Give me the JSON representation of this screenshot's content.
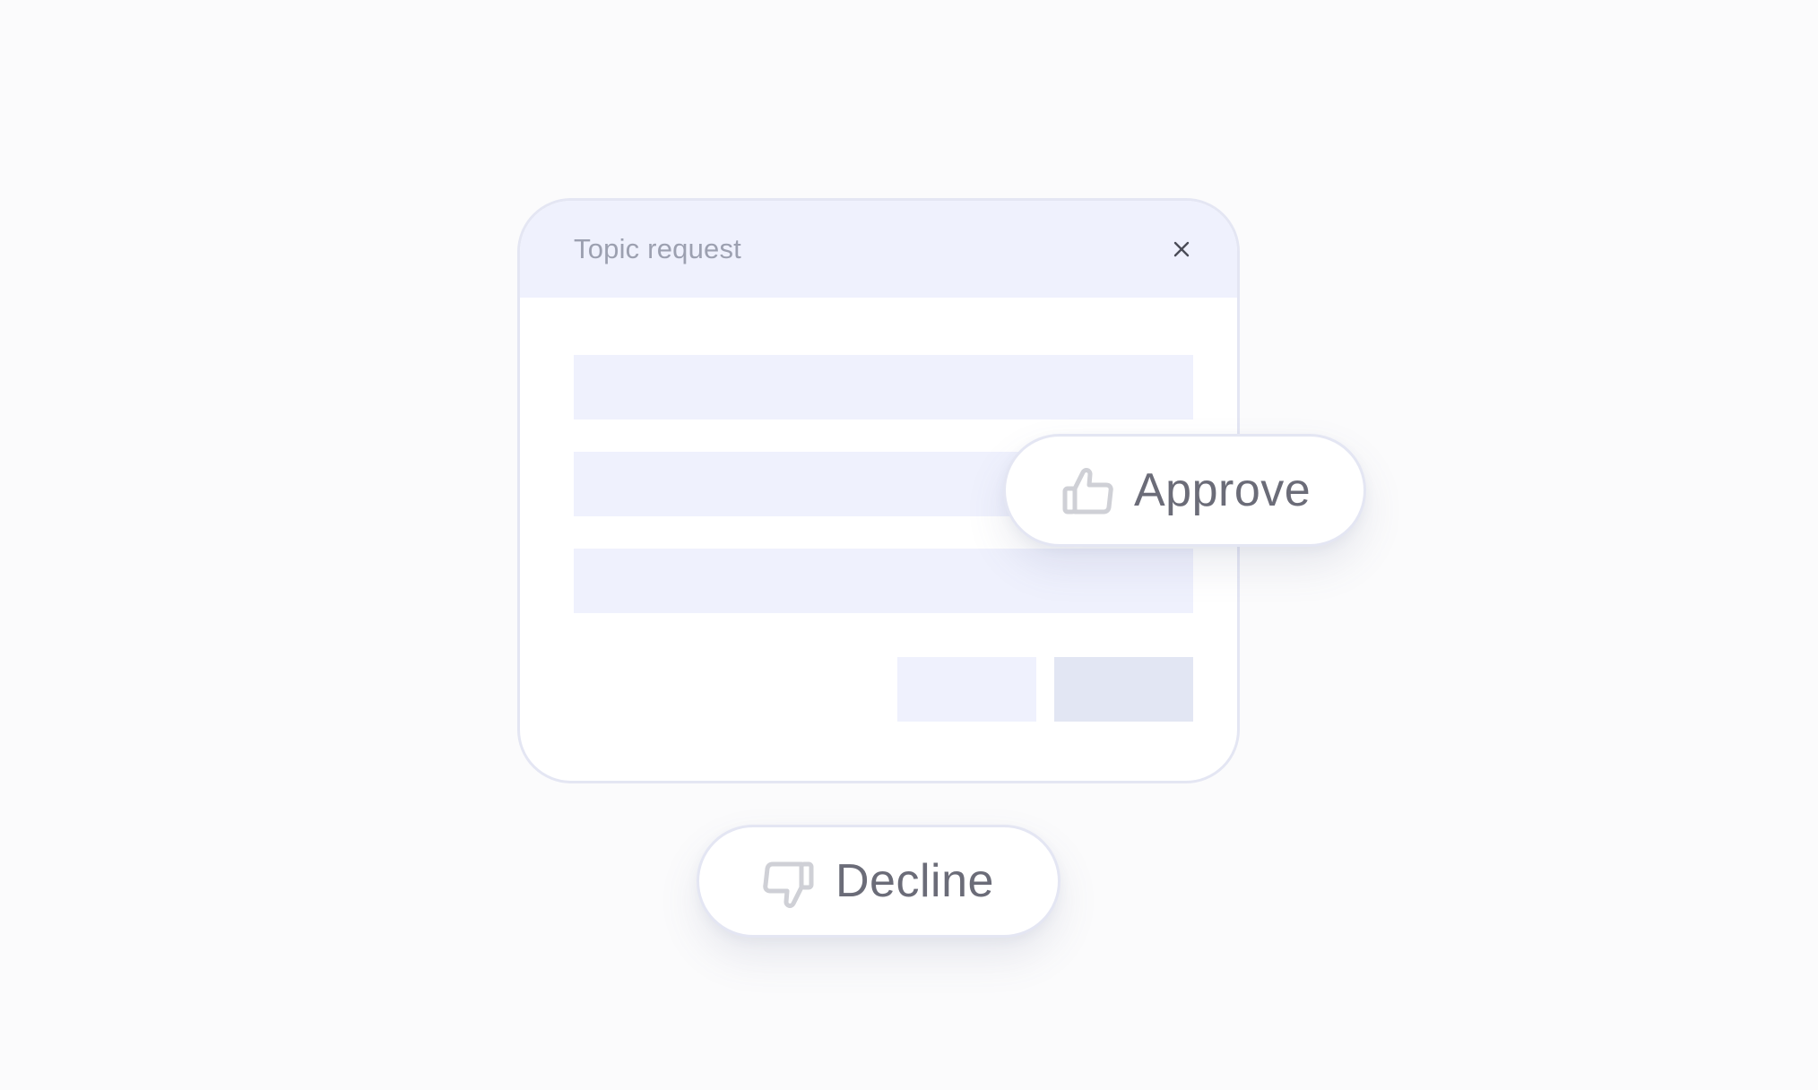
{
  "dialog": {
    "title": "Topic request",
    "close_icon": "close-icon"
  },
  "actions": {
    "approve": {
      "label": "Approve",
      "icon": "thumbs-up-icon"
    },
    "decline": {
      "label": "Decline",
      "icon": "thumbs-down-icon"
    }
  },
  "colors": {
    "background": "#fbfbfc",
    "header": "#eff1fd",
    "placeholder": "#eff1fd",
    "primary_placeholder": "#e2e6f3",
    "border": "#e4e6f3",
    "text_muted": "#9ca0b0",
    "text_label": "#6b6c78",
    "icon_stroke": "#cfd0d6"
  }
}
